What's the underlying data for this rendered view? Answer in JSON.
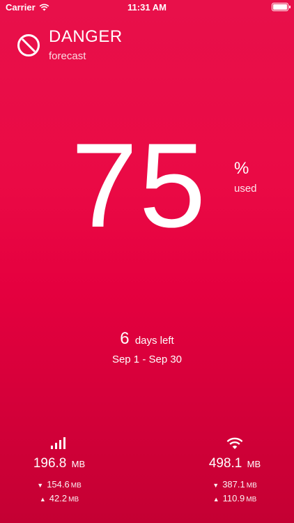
{
  "status_bar": {
    "carrier": "Carrier",
    "time": "11:31 AM"
  },
  "header": {
    "title": "DANGER",
    "subtitle": "forecast",
    "icon": "no-entry-icon"
  },
  "usage": {
    "percent": "75",
    "percent_sign": "%",
    "percent_label": "used"
  },
  "period": {
    "days_left_num": "6",
    "days_left_label": "days left",
    "date_range": "Sep 1 - Sep 30"
  },
  "cellular": {
    "icon": "cellular-signal-icon",
    "total_value": "196.8",
    "total_unit": "MB",
    "down_value": "154.6",
    "down_unit": "MB",
    "up_value": "42.2",
    "up_unit": "MB"
  },
  "wifi": {
    "icon": "wifi-icon",
    "total_value": "498.1",
    "total_unit": "MB",
    "down_value": "387.1",
    "down_unit": "MB",
    "up_value": "110.9",
    "up_unit": "MB"
  },
  "colors": {
    "background_top": "#e8104a",
    "background_bottom": "#c40033",
    "text": "#ffffff"
  }
}
